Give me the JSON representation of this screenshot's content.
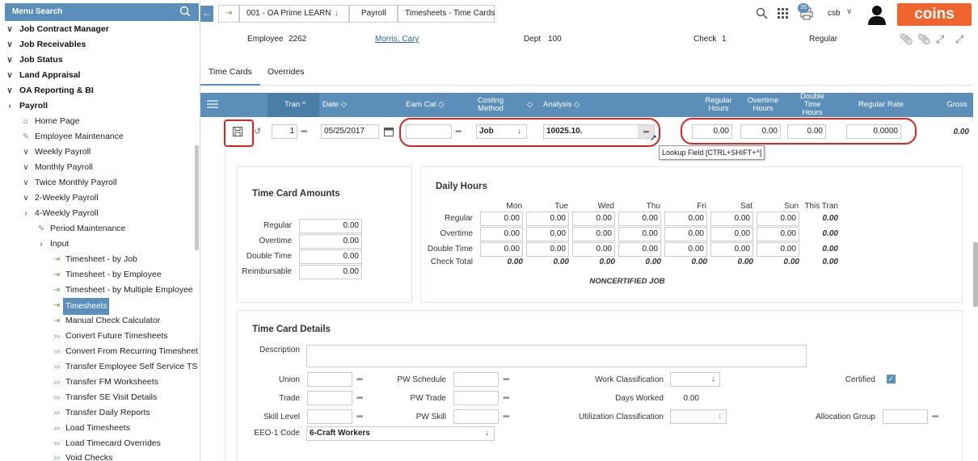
{
  "sidebar": {
    "search_label": "Menu Search",
    "items": [
      {
        "label": "Job Contract Manager"
      },
      {
        "label": "Job Receivables"
      },
      {
        "label": "Job Status"
      },
      {
        "label": "Land Appraisal"
      },
      {
        "label": "OA Reporting & BI"
      },
      {
        "label": "Payroll"
      },
      {
        "label": "Home Page"
      },
      {
        "label": "Employee Maintenance"
      },
      {
        "label": "Weekly Payroll"
      },
      {
        "label": "Monthly Payroll"
      },
      {
        "label": "Twice Monthly Payroll"
      },
      {
        "label": "2-Weekly Payroll"
      },
      {
        "label": "4-Weekly Payroll"
      },
      {
        "label": "Period Maintenance"
      },
      {
        "label": "Input"
      },
      {
        "label": "Timesheet - by Job"
      },
      {
        "label": "Timesheet - by Employee"
      },
      {
        "label": "Timesheet - by Multiple Employee"
      },
      {
        "label": "Timesheets"
      },
      {
        "label": "Manual Check Calculator"
      },
      {
        "label": "Convert Future Timesheets"
      },
      {
        "label": "Convert From Recurring Timesheet"
      },
      {
        "label": "Transfer Employee Self Service TS"
      },
      {
        "label": "Transfer FM Worksheets"
      },
      {
        "label": "Transfer SE Visit Details"
      },
      {
        "label": "Transfer Daily Reports"
      },
      {
        "label": "Load Timesheets"
      },
      {
        "label": "Load Timecard Overrides"
      },
      {
        "label": "Void Checks"
      }
    ]
  },
  "breadcrumb": {
    "company": "001 - OA Prime LEARN",
    "module": "Payroll",
    "page": "Timesheets - Time Cards"
  },
  "topbar": {
    "notif_count": "28",
    "user": "csb",
    "brand": "coins",
    "accent": "#f0642d",
    "primary": "#5b8fb9"
  },
  "header": {
    "employee_label": "Employee",
    "employee_id": "2262",
    "employee_name": "Morris, Cary",
    "dept_label": "Dept",
    "dept": "100",
    "check_label": "Check",
    "check": "1",
    "pay_type": "Regular"
  },
  "tabs": {
    "time_cards": "Time Cards",
    "overrides": "Overrides"
  },
  "grid": {
    "columns": {
      "tran": "Tran",
      "date": "Date",
      "earn_cat": "Earn Cat",
      "costing_method": "Costing Method",
      "analysis": "Analysis",
      "regular_hours": "Regular Hours",
      "overtime_hours": "Overtime Hours",
      "double_time_hours": "Double Time Hours",
      "regular_rate": "Regular Rate",
      "gross": "Gross"
    },
    "row": {
      "tran": "1",
      "date": "05/25/2017",
      "earn_cat": "",
      "costing_method": "Job",
      "analysis": "10025.10.",
      "regular_hours": "0.00",
      "overtime_hours": "0.00",
      "double_time_hours": "0.00",
      "regular_rate": "0.0000",
      "gross": "0.00"
    },
    "tooltip": "Lookup Field [CTRL+SHIFT+^]"
  },
  "amounts": {
    "title": "Time Card Amounts",
    "rows": [
      {
        "label": "Regular",
        "value": "0.00"
      },
      {
        "label": "Overtime",
        "value": "0.00"
      },
      {
        "label": "Double Time",
        "value": "0.00"
      },
      {
        "label": "Reimbursable",
        "value": "0.00"
      }
    ]
  },
  "daily": {
    "title": "Daily Hours",
    "days": [
      "Mon",
      "Tue",
      "Wed",
      "Thu",
      "Fri",
      "Sat",
      "Sun"
    ],
    "this_tran": "This Tran",
    "rows": [
      {
        "label": "Regular",
        "values": [
          "0.00",
          "0.00",
          "0.00",
          "0.00",
          "0.00",
          "0.00",
          "0.00"
        ],
        "tran": "0.00"
      },
      {
        "label": "Overtime",
        "values": [
          "0.00",
          "0.00",
          "0.00",
          "0.00",
          "0.00",
          "0.00",
          "0.00"
        ],
        "tran": "0.00"
      },
      {
        "label": "Double Time",
        "values": [
          "0.00",
          "0.00",
          "0.00",
          "0.00",
          "0.00",
          "0.00",
          "0.00"
        ],
        "tran": "0.00"
      }
    ],
    "check_total": {
      "label": "Check Total",
      "values": [
        "0.00",
        "0.00",
        "0.00",
        "0.00",
        "0.00",
        "0.00",
        "0.00"
      ],
      "tran": "0.00"
    },
    "note": "NONCERTIFIED JOB"
  },
  "details": {
    "title": "Time Card Details",
    "description_label": "Description",
    "union_label": "Union",
    "trade_label": "Trade",
    "skill_level_label": "Skill Level",
    "eeo_label": "EEO-1 Code",
    "eeo_value": "6-Craft Workers",
    "pw_schedule_label": "PW Schedule",
    "pw_trade_label": "PW Trade",
    "pw_skill_label": "PW Skill",
    "work_class_label": "Work Classification",
    "days_worked_label": "Days Worked",
    "days_worked": "0.00",
    "util_class_label": "Utilization Classification",
    "certified_label": "Certified",
    "allocation_label": "Allocation Group"
  }
}
